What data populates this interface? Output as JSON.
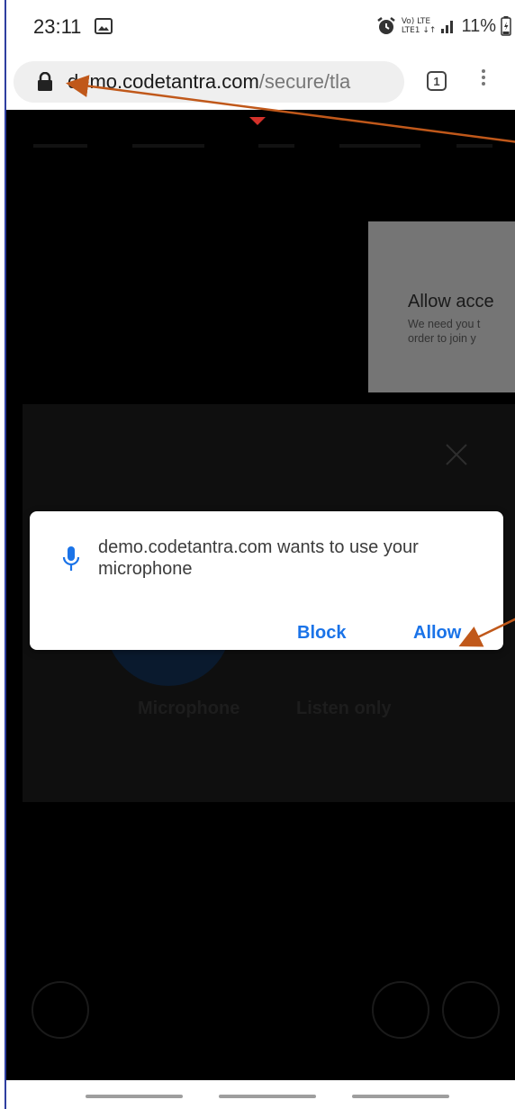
{
  "status_bar": {
    "time": "23:11",
    "network_line1": "Vo) LTE",
    "network_line2": "LTE1 ↓↑",
    "battery": "11%",
    "icons": [
      "gallery-icon",
      "alarm-icon",
      "signal-icon",
      "battery-icon"
    ]
  },
  "browser": {
    "url_host": "demo.codetantra.com",
    "url_path": "/secure/tla",
    "tab_count": "1"
  },
  "page": {
    "permission_title": "Allow acce",
    "permission_body_line1": "We need you t",
    "permission_body_line2": "order to join y",
    "audio_option_microphone": "Microphone",
    "audio_option_listen": "Listen only"
  },
  "dialog": {
    "message": "demo.codetantra.com wants to use your microphone",
    "block_label": "Block",
    "allow_label": "Allow"
  },
  "colors": {
    "accent": "#1a73e8",
    "annotation_arrow": "#c0581a",
    "page_background": "#000000"
  }
}
